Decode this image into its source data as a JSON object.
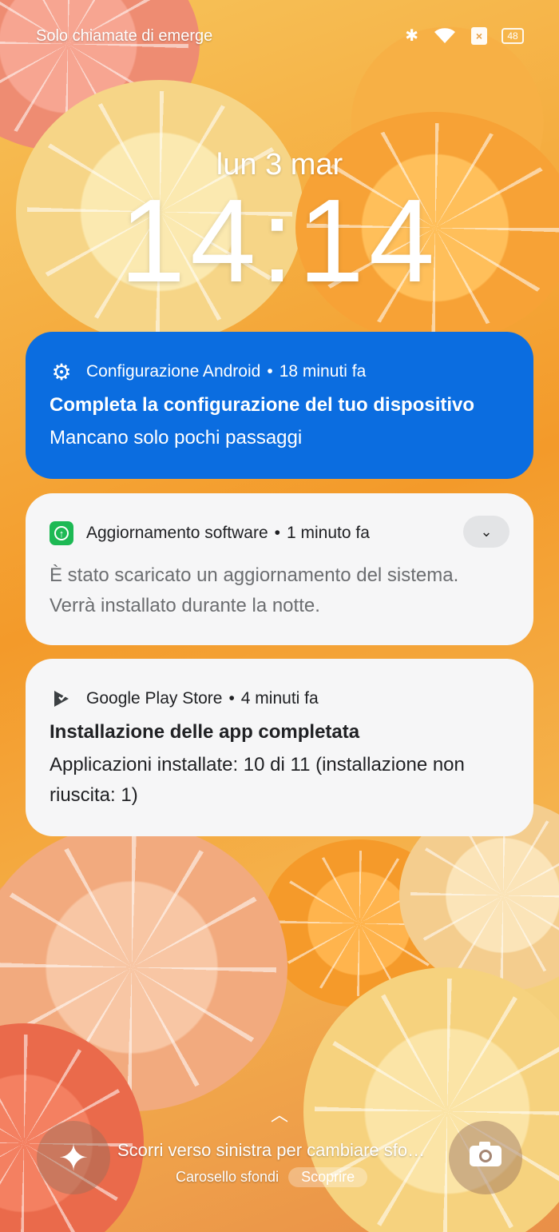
{
  "status_bar": {
    "carrier_text": "Solo chiamate di emerge",
    "battery_level": "48"
  },
  "lockscreen": {
    "date": "lun 3 mar",
    "time": "14:14"
  },
  "notifications": [
    {
      "app": "Configurazione Android",
      "time": "18 minuti fa",
      "title": "Completa la configurazione del tuo dispositivo",
      "body": "Mancano solo pochi passaggi",
      "icon": "gear-icon",
      "color": "#0b6de0"
    },
    {
      "app": "Aggiornamento software",
      "time": "1 minuto fa",
      "body": "È stato scaricato un aggiornamento del sistema. Verrà installato durante la notte.",
      "icon": "software-update-icon",
      "color": "#1db954"
    },
    {
      "app": "Google Play Store",
      "time": "4 minuti fa",
      "title": "Installazione delle app completata",
      "body": "Applicazioni installate: 10 di 11 (installazione non riuscita: 1)",
      "icon": "play-store-icon"
    }
  ],
  "bottom": {
    "hint": "Scorri verso sinistra per cambiare sfo…",
    "carousel_label": "Carosello sfondi",
    "discover_label": "Scoprire"
  }
}
